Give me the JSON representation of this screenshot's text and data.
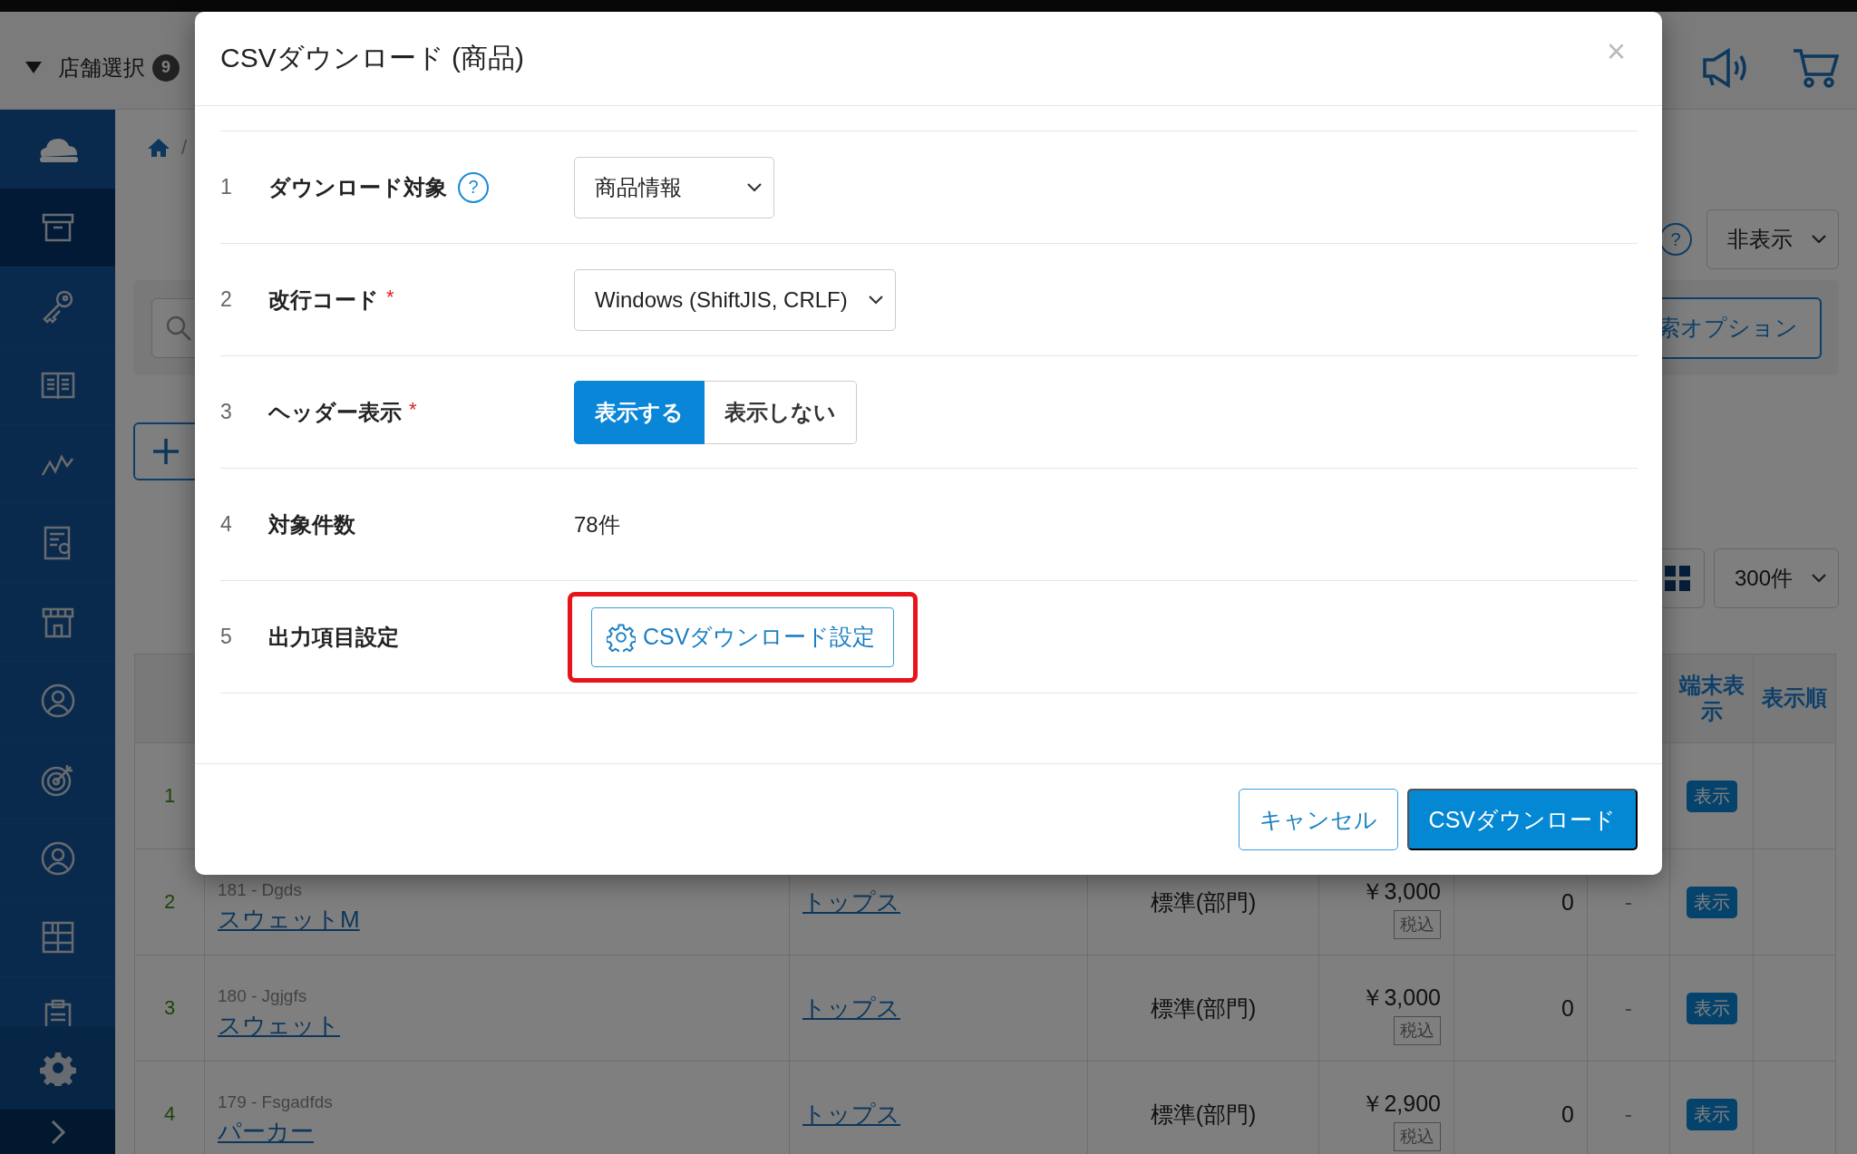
{
  "header": {
    "store_selector": {
      "label": "店舗選択",
      "badge": "9"
    }
  },
  "sidebar": {
    "items": [
      {
        "selected": true
      },
      {
        "selected": false
      },
      {
        "selected": false
      },
      {
        "selected": false
      },
      {
        "selected": false
      },
      {
        "selected": false
      },
      {
        "selected": false
      },
      {
        "selected": false
      },
      {
        "selected": false
      },
      {
        "selected": false
      },
      {
        "selected": false
      }
    ]
  },
  "breadcrumb": {
    "separator": "/"
  },
  "toolbar": {
    "help": "?",
    "visibility_select": "非表示",
    "search_options_button": "索オプション",
    "page_size_select": "300件"
  },
  "table": {
    "columns": [
      {
        "label": "端末表示"
      },
      {
        "label": "表示順"
      }
    ],
    "rows": [
      {
        "no": "1",
        "display": "表示"
      },
      {
        "no": "2",
        "code": "181 - Dgds",
        "name": "スウェットM",
        "category": "トップス",
        "type": "標準(部門)",
        "price": "￥3,000",
        "tax": "税込",
        "stock": "0",
        "column_7": "-",
        "display": "表示"
      },
      {
        "no": "3",
        "code": "180 - Jgjgfs",
        "name": "スウェット",
        "category": "トップス",
        "type": "標準(部門)",
        "price": "￥3,000",
        "tax": "税込",
        "stock": "0",
        "column_7": "-",
        "display": "表示"
      },
      {
        "no": "4",
        "code": "179 - Fsgadfds",
        "name": "パーカー",
        "category": "トップス",
        "type": "標準(部門)",
        "price": "￥2,900",
        "tax": "税込",
        "stock": "0",
        "column_7": "-",
        "display": "表示"
      }
    ]
  },
  "dialog": {
    "title": "CSVダウンロード (商品)",
    "close": "×",
    "fields": [
      {
        "no": "1",
        "label": "ダウンロード対象",
        "help": "?",
        "kind": "select",
        "value": "商品情報"
      },
      {
        "no": "2",
        "label": "改行コード",
        "required_mark": "*",
        "kind": "select",
        "value": "Windows (ShiftJIS, CRLF)"
      },
      {
        "no": "3",
        "label": "ヘッダー表示",
        "required_mark": "*",
        "kind": "toggle",
        "options": [
          {
            "label": "表示する",
            "selected": true
          },
          {
            "label": "表示しない",
            "selected": false
          }
        ]
      },
      {
        "no": "4",
        "label": "対象件数",
        "kind": "text",
        "value": "78件"
      },
      {
        "no": "5",
        "label": "出力項目設定",
        "kind": "button",
        "value": "CSVダウンロード設定",
        "highlighted": true
      }
    ],
    "buttons": [
      {
        "label": "キャンセル",
        "kind": "secondary"
      },
      {
        "label": "CSVダウンロード",
        "kind": "primary"
      }
    ]
  }
}
